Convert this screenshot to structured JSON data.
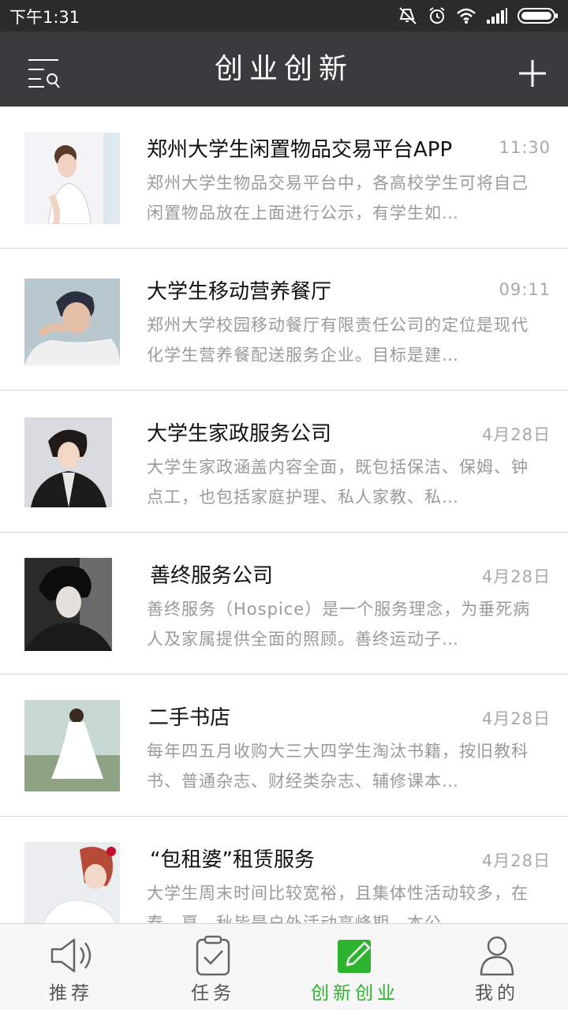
{
  "status_bar": {
    "time": "下午1:31",
    "icons": [
      "mute-icon",
      "alarm-icon",
      "wifi-icon",
      "signal-icon",
      "battery-icon"
    ]
  },
  "header": {
    "title": "创业创新",
    "left_icon": "menu-search-icon",
    "right_icon": "plus-icon",
    "background": "#393b3d"
  },
  "items": [
    {
      "title": "郑州大学生闲置物品交易平台APP",
      "time": "11:30",
      "description": "郑州大学生物品交易平台中，各高校学生可将自己闲置物品放在上面进行公示，有学生如…"
    },
    {
      "title": "大学生移动营养餐厅",
      "time": "09:11",
      "description": "郑州大学校园移动餐厅有限责任公司的定位是现代化学生营养餐配送服务企业。目标是建…"
    },
    {
      "title": "大学生家政服务公司",
      "time": "4月28日",
      "description": "大学生家政涵盖内容全面，既包括保洁、保姆、钟点工，也包括家庭护理、私人家教、私…"
    },
    {
      "title": "善终服务公司",
      "time": "4月28日",
      "description": "善终服务（Hospice）是一个服务理念，为垂死病人及家属提供全面的照顾。善终运动子…"
    },
    {
      "title": "二手书店",
      "time": "4月28日",
      "description": "每年四五月收购大三大四学生淘汰书籍，按旧教科书、普通杂志、财经类杂志、辅修课本…"
    },
    {
      "title": "“包租婆”租赁服务",
      "time": "4月28日",
      "description": "大学生周末时间比较宽裕，且集体性活动较多，在春、夏、秋皆是户外活动高峰期，本公…"
    }
  ],
  "bottom_nav": [
    {
      "label": "推荐",
      "icon": "speaker-icon",
      "active": false
    },
    {
      "label": "任务",
      "icon": "clipboard-check-icon",
      "active": false
    },
    {
      "label": "创新创业",
      "icon": "edit-icon",
      "active": true
    },
    {
      "label": "我的",
      "icon": "user-icon",
      "active": false
    }
  ],
  "colors": {
    "accent": "#2db32d",
    "time_text": "#a8a8a8",
    "description_text": "#9a9a9a"
  }
}
